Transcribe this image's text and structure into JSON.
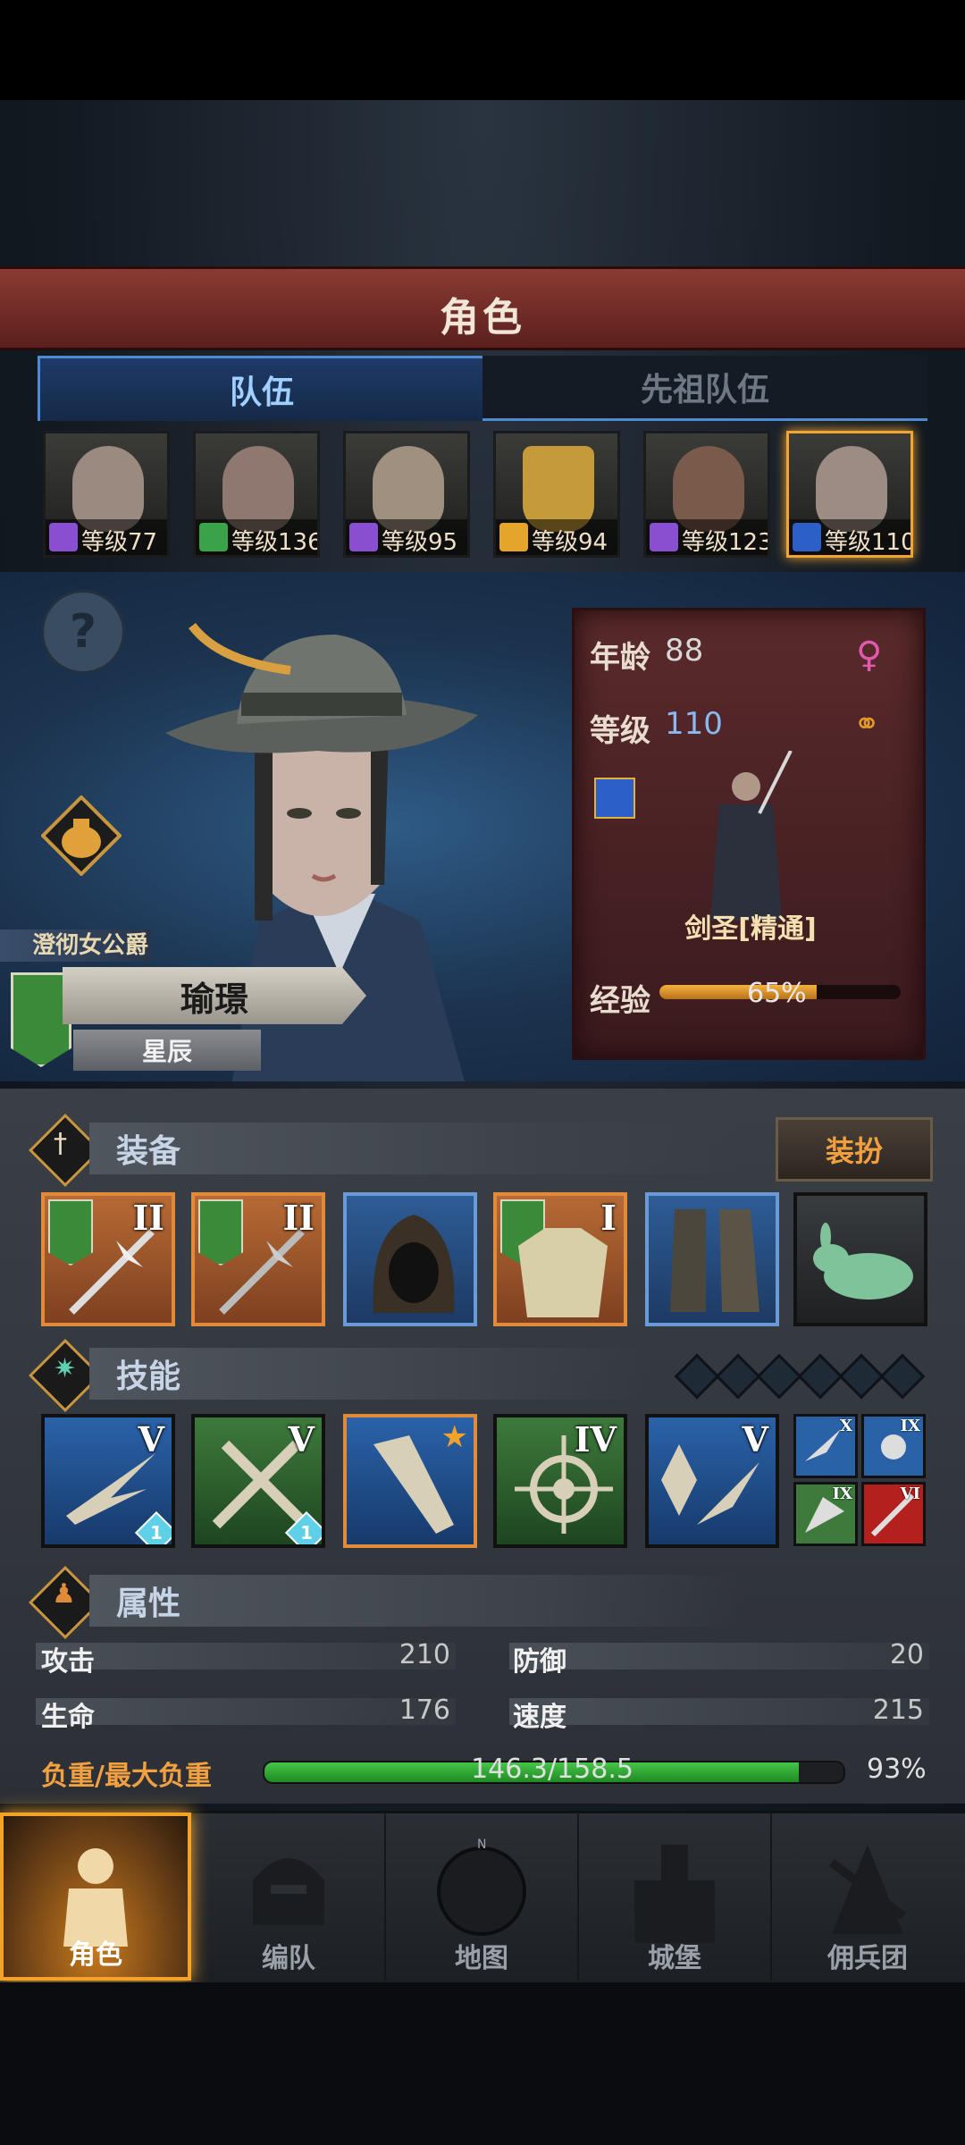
{
  "header": {
    "title": "角色"
  },
  "tabs": [
    {
      "label": "队伍"
    },
    {
      "label": "先祖队伍"
    }
  ],
  "roster": [
    {
      "level_text": "等级77",
      "class_color": "#8a4fd0"
    },
    {
      "level_text": "等级136",
      "class_color": "#3aa34a"
    },
    {
      "level_text": "等级95",
      "class_color": "#8a4fd0"
    },
    {
      "level_text": "等级94",
      "class_color": "#e5a52a"
    },
    {
      "level_text": "等级123",
      "class_color": "#8a4fd0"
    },
    {
      "level_text": "等级110",
      "class_color": "#2c5fc8",
      "selected": true
    }
  ],
  "character": {
    "title": "澄彻女公爵",
    "name": "瑜璟",
    "subtitle": "星辰",
    "age_label": "年龄",
    "age": "88",
    "level_label": "等级",
    "level": "110",
    "class_name": "剑圣[精通]",
    "exp_label": "经验",
    "exp_percent_text": "65%",
    "exp_fraction": 0.65
  },
  "equipment": {
    "section_title": "装备",
    "dress_button": "装扮",
    "slots": [
      {
        "icon": "halberd-icon",
        "rank": "II",
        "style": "orange"
      },
      {
        "icon": "halberd-icon",
        "rank": "II",
        "style": "orange"
      },
      {
        "icon": "hood-icon",
        "rank": "",
        "style": "blue"
      },
      {
        "icon": "armor-icon",
        "rank": "I",
        "style": "orange"
      },
      {
        "icon": "boots-icon",
        "rank": "",
        "style": "blue"
      },
      {
        "icon": "jade-rabbit-icon",
        "rank": "",
        "style": "dark"
      }
    ]
  },
  "skills": {
    "section_title": "技能",
    "main": [
      {
        "icon": "sword-slash-icon",
        "rank": "V",
        "badge": "1"
      },
      {
        "icon": "crossed-swords-icon",
        "rank": "V",
        "badge": "1"
      },
      {
        "icon": "blade-strike-icon",
        "rank": "",
        "star": true
      },
      {
        "icon": "target-icon",
        "rank": "IV"
      },
      {
        "icon": "crystal-strike-icon",
        "rank": "V"
      }
    ],
    "mini": [
      {
        "icon": "slash-icon",
        "rank": "X",
        "color": "#2a62a8"
      },
      {
        "icon": "burst-icon",
        "rank": "IX",
        "color": "#2a62a8"
      },
      {
        "icon": "leap-icon",
        "rank": "IX",
        "color": "#3d7a3c"
      },
      {
        "icon": "sword-icon",
        "rank": "VI",
        "color": "#b3201e"
      }
    ]
  },
  "attributes": {
    "section_title": "属性",
    "rows": [
      {
        "label": "攻击",
        "value": "210"
      },
      {
        "label": "防御",
        "value": "20"
      },
      {
        "label": "生命",
        "value": "176"
      },
      {
        "label": "速度",
        "value": "215"
      }
    ],
    "load_label": "负重/最大负重",
    "load_text": "146.3/158.5",
    "load_percent": "93%",
    "load_fraction": 0.923
  },
  "nav": [
    {
      "label": "角色",
      "icon": "knight-icon"
    },
    {
      "label": "编队",
      "icon": "helmet-icon"
    },
    {
      "label": "地图",
      "icon": "compass-icon"
    },
    {
      "label": "城堡",
      "icon": "castle-icon"
    },
    {
      "label": "佣兵团",
      "icon": "mercenary-icon"
    }
  ]
}
